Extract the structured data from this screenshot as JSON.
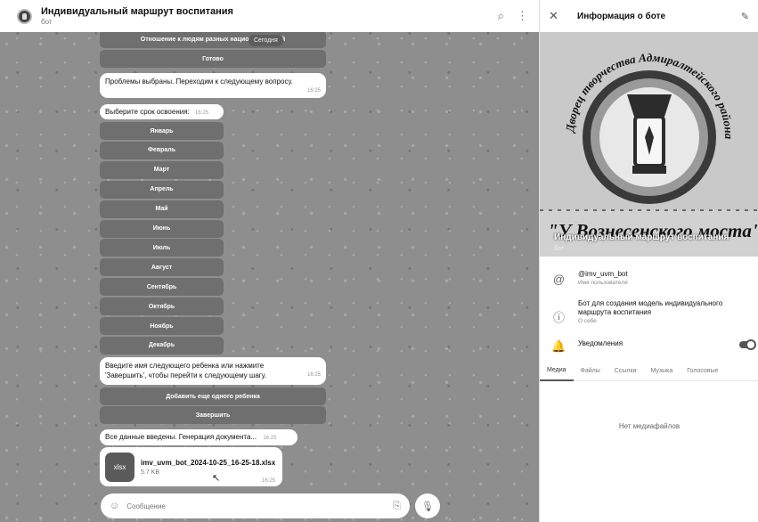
{
  "chat": {
    "title": "Индивидуальный маршрут воспитания",
    "subtitle": "бот",
    "date_label": "Сегодня",
    "top_buttons": [
      "Отношение к людям разных национальностей",
      "Готово"
    ],
    "msg_problems": {
      "text": "Проблемы выбраны. Переходим к следующему вопросу.",
      "time": "16:25"
    },
    "msg_period": {
      "text": "Выберите срок освоения:",
      "time": "16:25"
    },
    "months": [
      "Январь",
      "Февраль",
      "Март",
      "Апрель",
      "Май",
      "Июнь",
      "Июль",
      "Август",
      "Сентябрь",
      "Октябрь",
      "Ноябрь",
      "Декабрь"
    ],
    "msg_next_child": {
      "line1": "Введите имя следующего ребенка или нажмите",
      "line2": "'Завершить', чтобы перейти к следующему шагу.",
      "time": "16:25"
    },
    "buttons_child": [
      "Добавить еще одного ребенка",
      "Завершить"
    ],
    "msg_done": {
      "text": "Все данные введены. Генерация документа...",
      "time": "16:25"
    },
    "file": {
      "ext": "xlsx",
      "name": "imv_uvm_bot_2024-10-25_16-25-18.xlsx",
      "size": "5.7 KB",
      "time": "16:25"
    },
    "composer_placeholder": "Сообщение"
  },
  "info": {
    "title": "Информация о боте",
    "logo_arc_text": "Дворец творчества Адмиралтейского района Санкт-Петербурга",
    "logo_banner_text": "\"У Вознесенского моста\"",
    "name": "Индивидуальный маршрут воспитания",
    "sub": "бот",
    "username": "@imv_uvm_bot",
    "username_caption": "Имя пользователя",
    "about_line1": "Бот для создания модель индивидуального",
    "about_line2": "маршрута воспитания",
    "about_caption": "О себе",
    "notifications": "Уведомления",
    "notifications_on": true,
    "tabs": [
      "Медиа",
      "Файлы",
      "Ссылки",
      "Музыка",
      "Голосовые"
    ],
    "empty_text": "Нет медиафайлов"
  },
  "icons": {
    "search": "search-icon",
    "more": "more-vertical-icon",
    "close": "close-icon",
    "edit": "pencil-icon",
    "at": "at-icon",
    "info": "info-icon",
    "bell": "bell-icon",
    "emoji": "emoji-icon",
    "attach": "paperclip-icon",
    "mic": "microphone-icon"
  }
}
